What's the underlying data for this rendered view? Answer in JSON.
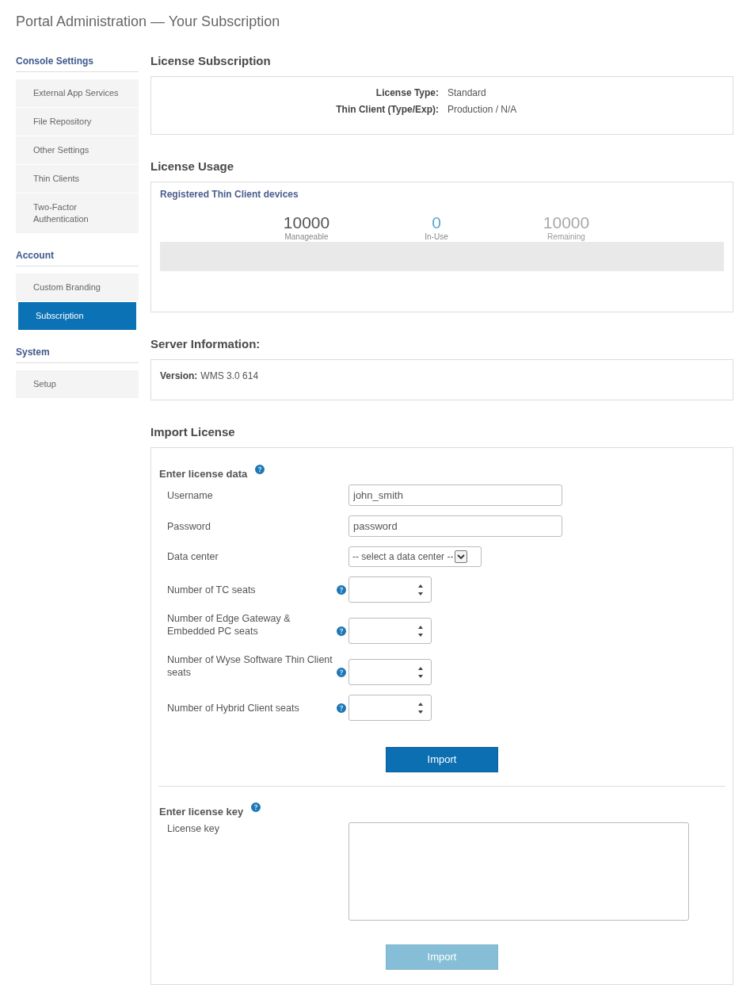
{
  "page": {
    "title": "Portal Administration — Your Subscription"
  },
  "sidebar": {
    "sections": [
      {
        "title": "Console Settings",
        "items": [
          {
            "label": "External App Services",
            "selected": false
          },
          {
            "label": "File Repository",
            "selected": false
          },
          {
            "label": "Other Settings",
            "selected": false
          },
          {
            "label": "Thin Clients",
            "selected": false
          },
          {
            "label": "Two-Factor Authentication",
            "selected": false
          }
        ]
      },
      {
        "title": "Account",
        "items": [
          {
            "label": "Custom Branding",
            "selected": false
          },
          {
            "label": "Subscription",
            "selected": true
          }
        ]
      },
      {
        "title": "System",
        "items": [
          {
            "label": "Setup",
            "selected": false
          }
        ]
      }
    ]
  },
  "license_subscription": {
    "heading": "License Subscription",
    "rows": [
      {
        "label": "License Type:",
        "value": "Standard"
      },
      {
        "label": "Thin Client (Type/Exp):",
        "value": "Production / N/A"
      }
    ]
  },
  "license_usage": {
    "heading": "License Usage",
    "title": "Registered Thin Client devices",
    "stats": [
      {
        "kind": "total",
        "value": "10000",
        "label": "Manageable"
      },
      {
        "kind": "used",
        "value": "0",
        "label": "In-Use"
      },
      {
        "kind": "remaining",
        "value": "10000",
        "label": "Remaining"
      }
    ],
    "usage_bar": {
      "level": 0
    }
  },
  "server_information": {
    "heading": "Server Information:",
    "rows": [
      {
        "label": "Version:",
        "value": "WMS 3.0 614"
      }
    ]
  },
  "import_license": {
    "heading": "Import License",
    "license_data": {
      "title": "Enter license data",
      "fields": [
        {
          "kind": "text",
          "label": "Username",
          "value": "john_smith",
          "help": false
        },
        {
          "kind": "text",
          "label": "Password",
          "value": "password",
          "help": false
        },
        {
          "kind": "select",
          "label": "Data center",
          "value": "-- select a data center --",
          "help": false
        },
        {
          "kind": "number",
          "label": "Number of TC seats",
          "help": true
        },
        {
          "kind": "number",
          "label": "Number of Edge Gateway & Embedded PC seats",
          "help": true
        },
        {
          "kind": "number",
          "label": "Number of Wyse Software Thin Client seats",
          "help": true
        },
        {
          "kind": "number",
          "label": "Number of Hybrid Client seats",
          "help": true
        }
      ],
      "button": {
        "label": "Import",
        "disabled": false
      }
    },
    "license_key": {
      "title": "Enter license key",
      "label": "License key",
      "button": {
        "label": "Import",
        "disabled": true
      }
    }
  }
}
